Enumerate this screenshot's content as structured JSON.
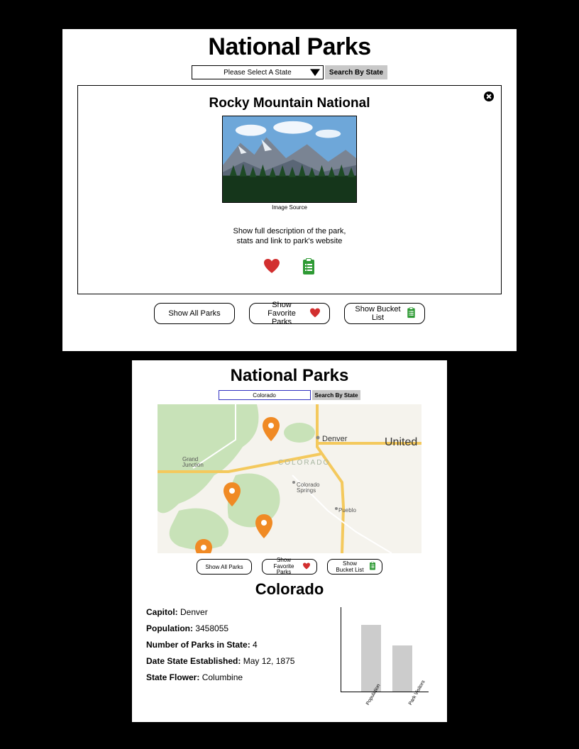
{
  "top": {
    "title": "National Parks",
    "state_placeholder": "Please Select A State",
    "search_label": "Search By State",
    "card": {
      "park_title": "Rocky Mountain National",
      "image_source": "Image Source",
      "desc_line1": "Show full description of the park,",
      "desc_line2": "stats and link to park's website"
    },
    "buttons": {
      "all": "Show All Parks",
      "fav_line1": "Show Favorite",
      "fav_line2": "Parks",
      "bucket": "Show Bucket List"
    }
  },
  "bottom": {
    "title": "National Parks",
    "state_value": "Colorado",
    "search_label": "Search By State",
    "map_labels": {
      "denver": "Denver",
      "junction": "Grand\nJunction",
      "state": "COLORADO",
      "csprings": "Colorado\nSprings",
      "pueblo": "Pueblo",
      "united": "United"
    },
    "buttons": {
      "all": "Show All Parks",
      "fav_line1": "Show Favorite",
      "fav_line2": "Parks",
      "bucket": "Show Bucket List"
    },
    "state_name": "Colorado",
    "info": {
      "capitol_label": "Capitol:",
      "capitol_value": " Denver",
      "pop_label": "Population:",
      "pop_value": " 3458055",
      "parks_label": "Number of Parks in State:",
      "parks_value": " 4",
      "est_label": "Date State Established:",
      "est_value": " May 12, 1875",
      "flower_label": "State Flower:",
      "flower_value": " Columbine"
    }
  },
  "chart_data": {
    "type": "bar",
    "categories": [
      "Population",
      "Park Visitors"
    ],
    "values": [
      80,
      55
    ],
    "title": "",
    "xlabel": "",
    "ylabel": "",
    "ylim": [
      0,
      100
    ]
  },
  "colors": {
    "heart": "#d22f2f",
    "clipboard": "#2e9a34",
    "pin": "#f08a24"
  }
}
